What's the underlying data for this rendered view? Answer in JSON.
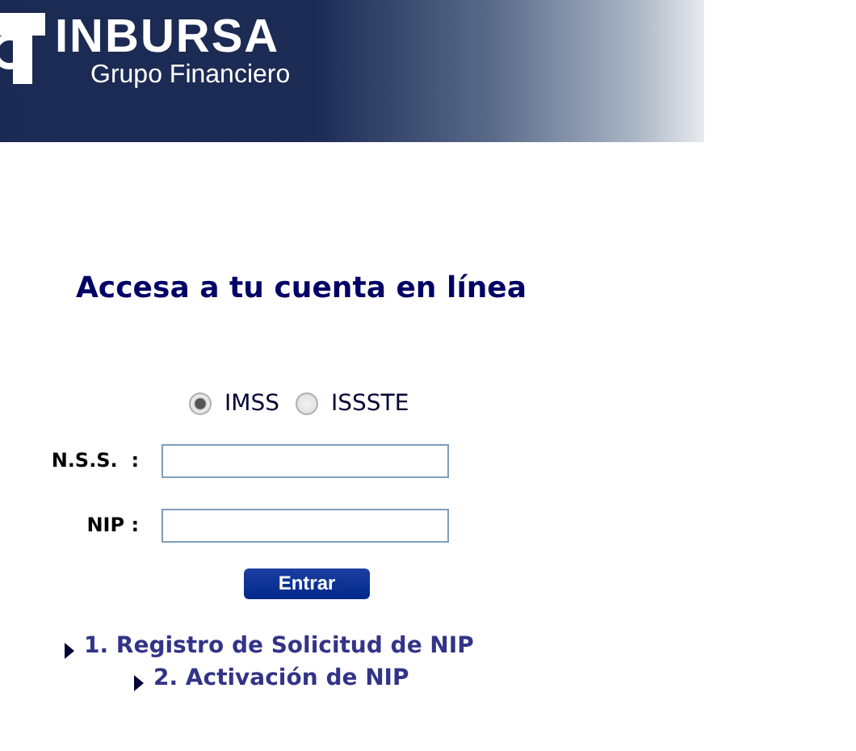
{
  "header": {
    "brand": "INBURSA",
    "subtitle": "Grupo Financiero"
  },
  "title": "Accesa a tu cuenta en línea",
  "institutions": [
    {
      "label": "IMSS",
      "selected": true
    },
    {
      "label": "ISSSTE",
      "selected": false
    }
  ],
  "fields": [
    {
      "label": "N.S.S.  :"
    },
    {
      "label": "NIP :"
    }
  ],
  "submit": "Entrar",
  "links": [
    {
      "label": "1. Registro de Solicitud de NIP",
      "children": [
        {
          "label": "2. Activación de NIP"
        }
      ]
    }
  ]
}
